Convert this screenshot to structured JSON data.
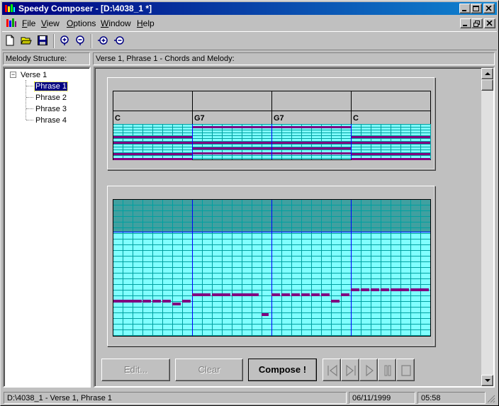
{
  "window": {
    "title": "Speedy Composer - [D:\\4038_1 *]",
    "titlebar_color_start": "#000080",
    "titlebar_color_end": "#1084d0",
    "controls": [
      "minimize-icon",
      "maximize-icon",
      "close-icon"
    ]
  },
  "menu": {
    "items": [
      "File",
      "View",
      "Options",
      "Window",
      "Help"
    ],
    "mdi_controls": [
      "minimize-icon",
      "restore-icon",
      "close-icon"
    ]
  },
  "toolbar": {
    "buttons": [
      "new-file-icon",
      "open-folder-icon",
      "save-disk-icon",
      "zoom-in-icon",
      "zoom-out-icon",
      "zoom-in-horizontal-icon",
      "zoom-out-horizontal-icon"
    ]
  },
  "left_pane": {
    "header": "Melody Structure:",
    "tree": {
      "root": "Verse 1",
      "children": [
        "Phrase 1",
        "Phrase 2",
        "Phrase 3",
        "Phrase 4"
      ],
      "selected_index": 0
    }
  },
  "right_pane": {
    "header": "Verse 1, Phrase 1 - Chords and Melody:"
  },
  "chords": {
    "labels": [
      "C",
      "G7",
      "G7",
      "C"
    ],
    "grid_color": "#00a0a0",
    "note_color": "#800080",
    "background": "#80ffff"
  },
  "melody": {
    "top_band_color": "#40a0a0",
    "background": "#80ffff",
    "bar_line_color": "#0000ff",
    "note_color": "#800080"
  },
  "buttons": {
    "edit": "Edit...",
    "clear": "Clear",
    "compose": "Compose !",
    "transport": [
      "skip-to-start-icon",
      "skip-to-end-icon",
      "play-icon",
      "pause-icon",
      "stop-icon"
    ]
  },
  "status": {
    "path": "D:\\4038_1 - Verse 1, Phrase 1",
    "date": "06/11/1999",
    "time": "05:58"
  }
}
